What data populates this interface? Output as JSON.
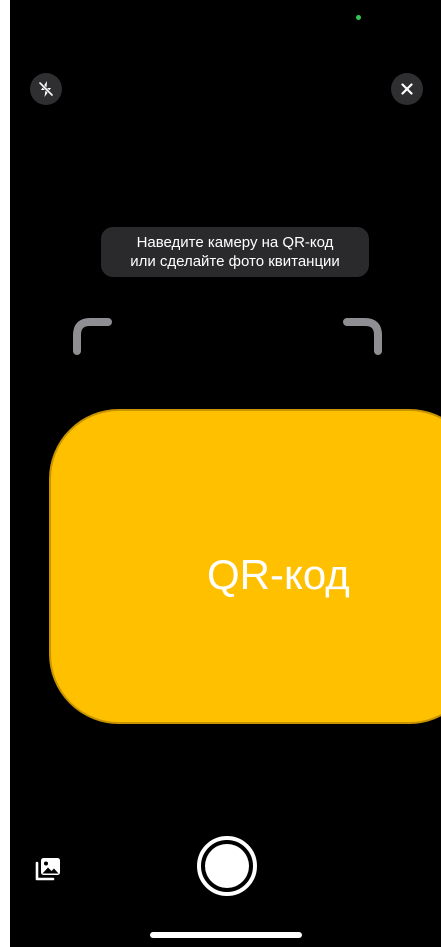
{
  "status": {
    "camera_indicator": "green-dot-icon"
  },
  "top_bar": {
    "flash_icon": "flash-off-icon",
    "close_icon": "close-icon",
    "close_glyph": "✕"
  },
  "hint": {
    "line1": "Наведите камеру на QR-код",
    "line2": "или сделайте фото квитанции"
  },
  "qr_card": {
    "label": "QR-код",
    "color": "#ffc000"
  },
  "bottom_bar": {
    "gallery_icon": "photo-gallery-icon",
    "shutter_icon": "shutter-icon"
  }
}
